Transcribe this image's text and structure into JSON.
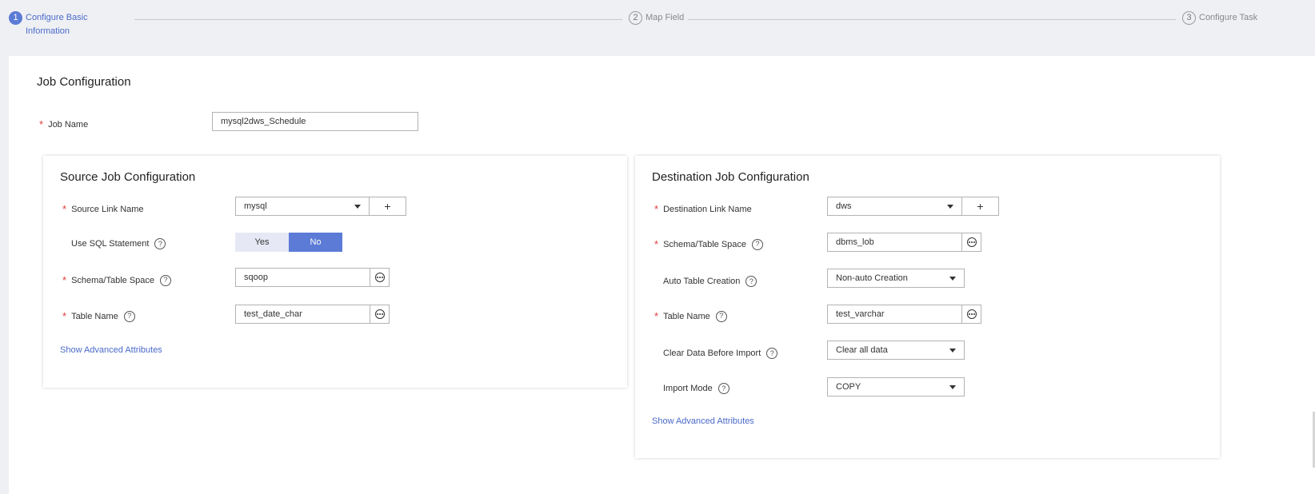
{
  "steps": [
    {
      "num": "1",
      "label_line1": "Configure Basic",
      "label_line2": "Information",
      "state": "active"
    },
    {
      "num": "2",
      "label": "Map Field",
      "state": "todo"
    },
    {
      "num": "3",
      "label": "Configure Task",
      "state": "todo"
    }
  ],
  "job": {
    "section_title": "Job Configuration",
    "name_label": "Job Name",
    "name_value": "mysql2dws_Schedule"
  },
  "source": {
    "title": "Source Job Configuration",
    "link_label": "Source Link Name",
    "link_value": "mysql",
    "add_symbol": "+",
    "use_sql_label": "Use SQL Statement",
    "use_sql_yes": "Yes",
    "use_sql_no": "No",
    "use_sql_selected": "No",
    "schema_label": "Schema/Table Space",
    "schema_value": "sqoop",
    "table_label": "Table Name",
    "table_value": "test_date_char",
    "advanced_link": "Show Advanced Attributes"
  },
  "destination": {
    "title": "Destination Job Configuration",
    "link_label": "Destination Link Name",
    "link_value": "dws",
    "add_symbol": "+",
    "schema_label": "Schema/Table Space",
    "schema_value": "dbms_lob",
    "auto_table_label": "Auto Table Creation",
    "auto_table_value": "Non-auto Creation",
    "table_label": "Table Name",
    "table_value": "test_varchar",
    "clear_label": "Clear Data Before Import",
    "clear_value": "Clear all data",
    "import_mode_label": "Import Mode",
    "import_mode_value": "COPY",
    "advanced_link": "Show Advanced Attributes"
  },
  "help_symbol": "?",
  "required_symbol": "*",
  "colors": {
    "accent": "#5b7bd6",
    "link": "#4a6ac8",
    "required": "#e03a3a",
    "page_bg": "#eff0f4"
  }
}
